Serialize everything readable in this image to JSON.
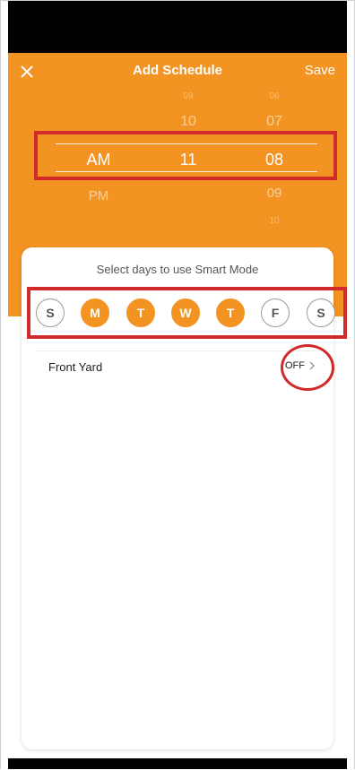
{
  "header": {
    "title": "Add Schedule",
    "save_label": "Save",
    "close_icon": "close-icon"
  },
  "picker": {
    "period": {
      "above": "",
      "selected": "AM",
      "below": "PM"
    },
    "hour": {
      "faint_above": "09",
      "above": "10",
      "selected": "11",
      "below": ""
    },
    "minute": {
      "faint_above": "06",
      "above": "07",
      "selected": "08",
      "below": "09",
      "faint_below": "10"
    }
  },
  "days_section": {
    "subtitle": "Select days to use Smart Mode",
    "days": [
      {
        "label": "S",
        "selected": false
      },
      {
        "label": "M",
        "selected": true
      },
      {
        "label": "T",
        "selected": true
      },
      {
        "label": "W",
        "selected": true
      },
      {
        "label": "T",
        "selected": true
      },
      {
        "label": "F",
        "selected": false
      },
      {
        "label": "S",
        "selected": false
      }
    ]
  },
  "zone": {
    "label": "Front Yard",
    "status": "OFF",
    "chevron_icon": "chevron-right-icon"
  },
  "colors": {
    "accent": "#f39322",
    "annotation": "#d12a2a"
  }
}
